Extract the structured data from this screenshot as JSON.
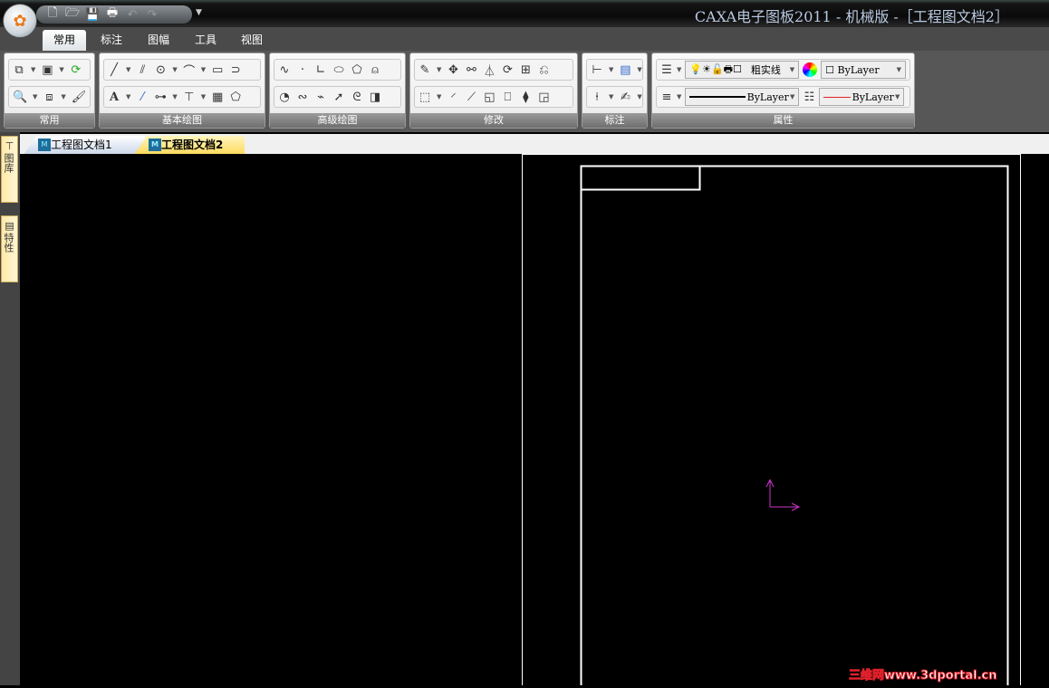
{
  "window": {
    "title": "CAXA电子图板2011 - 机械版 -［工程图文档2］"
  },
  "qat": {
    "icons": [
      "new-icon",
      "open-icon",
      "save-icon",
      "print-icon",
      "undo-icon",
      "redo-icon"
    ]
  },
  "ribbon_tabs": [
    {
      "label": "常用",
      "active": true
    },
    {
      "label": "标注"
    },
    {
      "label": "图幅"
    },
    {
      "label": "工具"
    },
    {
      "label": "视图"
    }
  ],
  "groups": {
    "common": {
      "label": "常用"
    },
    "basic_draw": {
      "label": "基本绘图"
    },
    "advanced_draw": {
      "label": "高级绘图"
    },
    "modify": {
      "label": "修改"
    },
    "dimension": {
      "label": "标注"
    },
    "properties": {
      "label": "属性",
      "layer_value": "粗实线",
      "color_value": "ByLayer",
      "linetype_value": "ByLayer",
      "lineweight_value": "ByLayer",
      "accent_line_color": "#e02020"
    }
  },
  "doc_tabs": [
    {
      "label": "工程图文档1",
      "active": false
    },
    {
      "label": "工程图文档2",
      "active": true
    }
  ],
  "side_tabs": [
    {
      "label": "图库"
    },
    {
      "label": "特性"
    }
  ],
  "watermark": "三维网www.3dportal.cn",
  "colors": {
    "canvas": "#000000",
    "drawing_lines": "#ffffff",
    "axis": "#cc33cc",
    "active_tab": "#ffe27a"
  }
}
